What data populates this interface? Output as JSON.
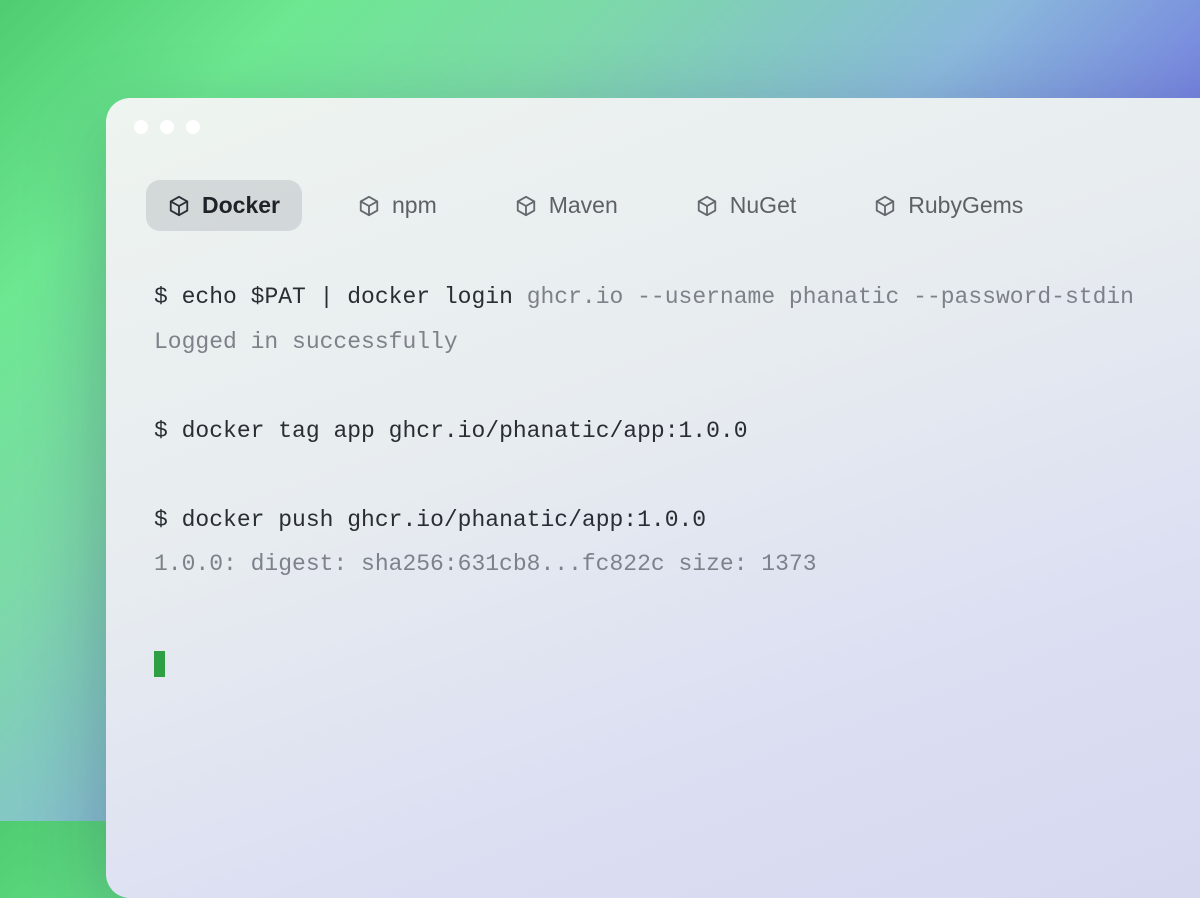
{
  "tabs": [
    {
      "label": "Docker",
      "active": true
    },
    {
      "label": "npm",
      "active": false
    },
    {
      "label": "Maven",
      "active": false
    },
    {
      "label": "NuGet",
      "active": false
    },
    {
      "label": "RubyGems",
      "active": false
    }
  ],
  "terminal": {
    "prompt": "$",
    "line1_dark": "echo $PAT | docker login ",
    "line1_gray": "ghcr.io --username phanatic --password-stdin",
    "line1_out": "Logged in successfully",
    "line2_dark": "docker tag app ghcr.io/phanatic/app:1.0.0",
    "line3_dark": "docker push ghcr.io/phanatic/app:1.0.0",
    "line3_out": "1.0.0: digest: sha256:631cb8...fc822c size: 1373"
  }
}
